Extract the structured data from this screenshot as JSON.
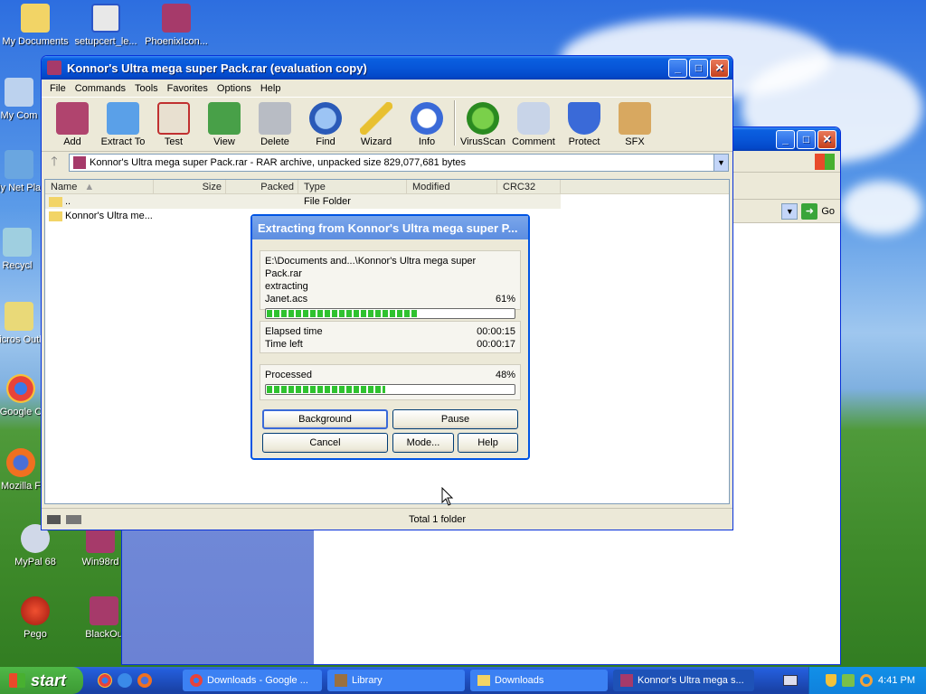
{
  "desktop": {
    "icons": [
      "My Documents",
      "setupcert_le...",
      "PhoenixIcon...",
      "My Com",
      "My Net Plac",
      "Recycl",
      "Micros Outlo",
      "Google C",
      "Mozilla F",
      "MyPal 68",
      "Win98rd",
      "Pego",
      "BlackOu"
    ]
  },
  "bgwin": {
    "go": "Go"
  },
  "winrar": {
    "title": "Konnor's Ultra mega super Pack.rar (evaluation copy)",
    "menu": [
      "File",
      "Commands",
      "Tools",
      "Favorites",
      "Options",
      "Help"
    ],
    "tools": [
      "Add",
      "Extract To",
      "Test",
      "View",
      "Delete",
      "Find",
      "Wizard",
      "Info",
      "VirusScan",
      "Comment",
      "Protect",
      "SFX"
    ],
    "address": "Konnor's Ultra mega super Pack.rar - RAR archive, unpacked size 829,077,681 bytes",
    "columns": [
      "Name",
      "Size",
      "Packed",
      "Type",
      "Modified",
      "CRC32"
    ],
    "rows": [
      {
        "name": "..",
        "type": "File Folder"
      },
      {
        "name": "Konnor's Ultra me...",
        "type": ""
      }
    ],
    "status": "Total 1 folder"
  },
  "dialog": {
    "title": "Extracting from Konnor's Ultra mega super P...",
    "path": "E:\\Documents and...\\Konnor's Ultra mega super Pack.rar",
    "action": "extracting",
    "file": "Janet.acs",
    "file_pct": "61%",
    "file_progress": 0.61,
    "elapsed_label": "Elapsed time",
    "elapsed": "00:00:15",
    "left_label": "Time left",
    "left": "00:00:17",
    "processed_label": "Processed",
    "processed_pct": "48%",
    "processed_progress": 0.48,
    "btn_background": "Background",
    "btn_pause": "Pause",
    "btn_cancel": "Cancel",
    "btn_mode": "Mode...",
    "btn_help": "Help"
  },
  "taskbar": {
    "start": "start",
    "tasks": [
      "Downloads - Google ...",
      "Library",
      "Downloads",
      "Konnor's Ultra mega s..."
    ],
    "time": "4:41 PM"
  }
}
